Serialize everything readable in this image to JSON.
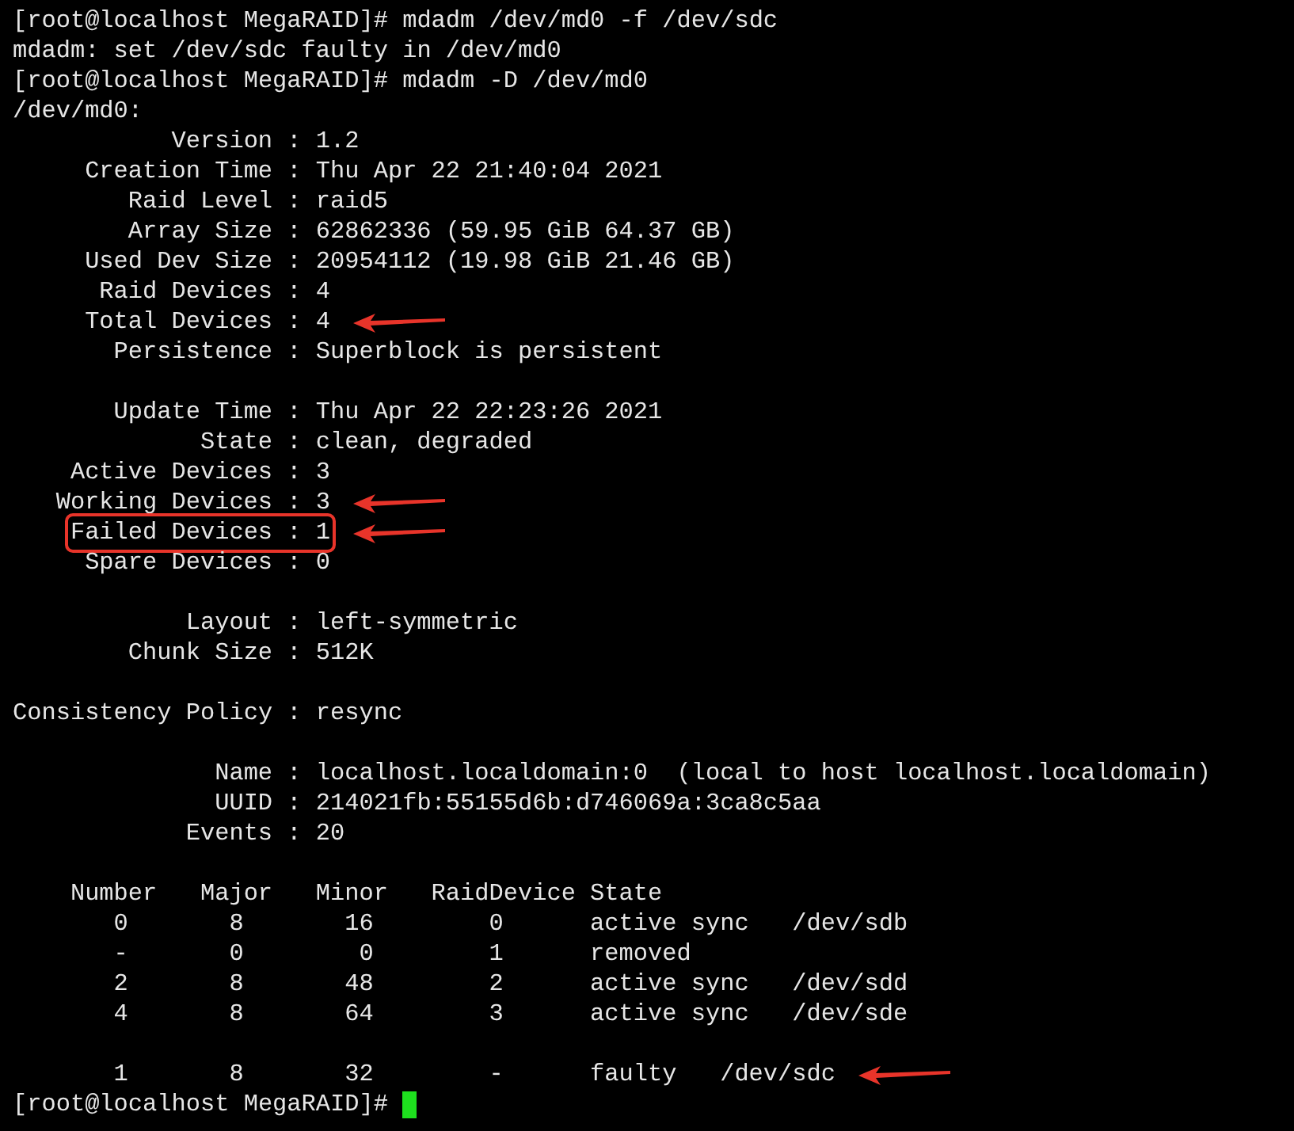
{
  "terminal": {
    "lines": [
      {
        "kind": "prompt",
        "text": "[root@localhost MegaRAID]# mdadm /dev/md0 -f /dev/sdc"
      },
      {
        "kind": "output",
        "text": "mdadm: set /dev/sdc faulty in /dev/md0"
      },
      {
        "kind": "prompt",
        "text": "[root@localhost MegaRAID]# mdadm -D /dev/md0"
      },
      {
        "kind": "output",
        "text": "/dev/md0:"
      },
      {
        "kind": "output",
        "text": "           Version : 1.2"
      },
      {
        "kind": "output",
        "text": "     Creation Time : Thu Apr 22 21:40:04 2021"
      },
      {
        "kind": "output",
        "text": "        Raid Level : raid5"
      },
      {
        "kind": "output",
        "text": "        Array Size : 62862336 (59.95 GiB 64.37 GB)"
      },
      {
        "kind": "output",
        "text": "     Used Dev Size : 20954112 (19.98 GiB 21.46 GB)"
      },
      {
        "kind": "output",
        "text": "      Raid Devices : 4"
      },
      {
        "kind": "output",
        "text": "     Total Devices : 4",
        "arrow": true
      },
      {
        "kind": "output",
        "text": "       Persistence : Superblock is persistent"
      },
      {
        "kind": "blank"
      },
      {
        "kind": "output",
        "text": "       Update Time : Thu Apr 22 22:23:26 2021"
      },
      {
        "kind": "output",
        "text": "             State : clean, degraded"
      },
      {
        "kind": "output",
        "text": "    Active Devices : 3"
      },
      {
        "kind": "output",
        "text": "   Working Devices : 3",
        "arrow": true
      },
      {
        "kind": "output",
        "text": "    Failed Devices : 1",
        "arrow": true,
        "boxed": true
      },
      {
        "kind": "output",
        "text": "     Spare Devices : 0"
      },
      {
        "kind": "blank"
      },
      {
        "kind": "output",
        "text": "            Layout : left-symmetric"
      },
      {
        "kind": "output",
        "text": "        Chunk Size : 512K"
      },
      {
        "kind": "blank"
      },
      {
        "kind": "output",
        "text": "Consistency Policy : resync"
      },
      {
        "kind": "blank"
      },
      {
        "kind": "output",
        "text": "              Name : localhost.localdomain:0  (local to host localhost.localdomain)"
      },
      {
        "kind": "output",
        "text": "              UUID : 214021fb:55155d6b:d746069a:3ca8c5aa"
      },
      {
        "kind": "output",
        "text": "            Events : 20"
      },
      {
        "kind": "blank"
      },
      {
        "kind": "output",
        "text": "    Number   Major   Minor   RaidDevice State"
      },
      {
        "kind": "output",
        "text": "       0       8       16        0      active sync   /dev/sdb"
      },
      {
        "kind": "output",
        "text": "       -       0        0        1      removed"
      },
      {
        "kind": "output",
        "text": "       2       8       48        2      active sync   /dev/sdd"
      },
      {
        "kind": "output",
        "text": "       4       8       64        3      active sync   /dev/sde"
      },
      {
        "kind": "blank"
      },
      {
        "kind": "output",
        "text": "       1       8       32        -      faulty   /dev/sdc",
        "arrow": true
      },
      {
        "kind": "prompt",
        "text": "[root@localhost MegaRAID]#",
        "cursor": true
      }
    ]
  }
}
